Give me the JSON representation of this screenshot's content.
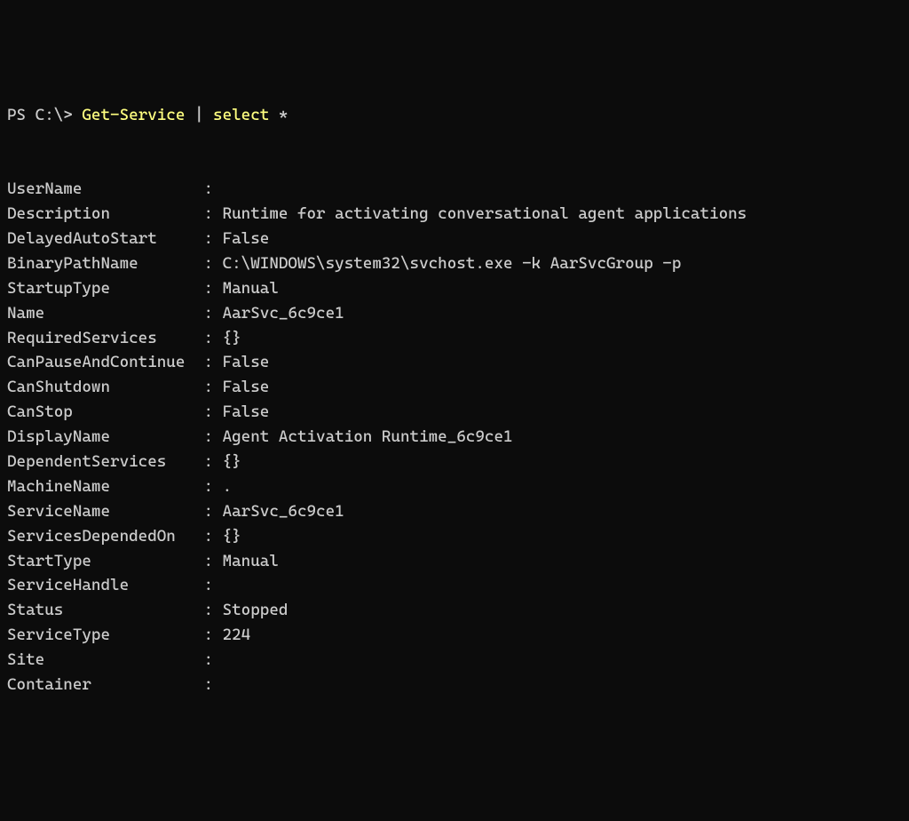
{
  "prompt": {
    "prefix": "PS C:\\> ",
    "cmd_part1": "Get-Service",
    "pipe": " | ",
    "cmd_part2": "select",
    "cmd_rest": " *"
  },
  "properties": [
    {
      "name": "UserName",
      "value": ""
    },
    {
      "name": "Description",
      "value": "Runtime for activating conversational agent applications"
    },
    {
      "name": "DelayedAutoStart",
      "value": "False"
    },
    {
      "name": "BinaryPathName",
      "value": "C:\\WINDOWS\\system32\\svchost.exe -k AarSvcGroup -p"
    },
    {
      "name": "StartupType",
      "value": "Manual"
    },
    {
      "name": "Name",
      "value": "AarSvc_6c9ce1"
    },
    {
      "name": "RequiredServices",
      "value": "{}"
    },
    {
      "name": "CanPauseAndContinue",
      "value": "False"
    },
    {
      "name": "CanShutdown",
      "value": "False"
    },
    {
      "name": "CanStop",
      "value": "False"
    },
    {
      "name": "DisplayName",
      "value": "Agent Activation Runtime_6c9ce1"
    },
    {
      "name": "DependentServices",
      "value": "{}"
    },
    {
      "name": "MachineName",
      "value": "."
    },
    {
      "name": "ServiceName",
      "value": "AarSvc_6c9ce1"
    },
    {
      "name": "ServicesDependedOn",
      "value": "{}"
    },
    {
      "name": "StartType",
      "value": "Manual"
    },
    {
      "name": "ServiceHandle",
      "value": ""
    },
    {
      "name": "Status",
      "value": "Stopped"
    },
    {
      "name": "ServiceType",
      "value": "224"
    },
    {
      "name": "Site",
      "value": ""
    },
    {
      "name": "Container",
      "value": ""
    }
  ],
  "separator": ": ",
  "name_col_width": 20
}
